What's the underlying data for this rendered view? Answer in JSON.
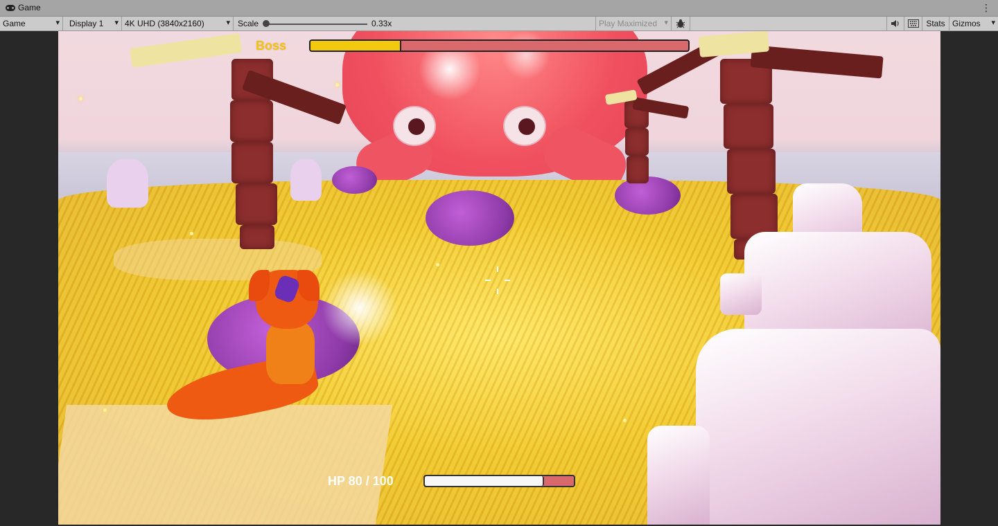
{
  "window": {
    "tab_title": "Game",
    "tab_icon": "gamepad-icon",
    "menu_icon": "kebab-menu-icon"
  },
  "toolbar": {
    "view_select": "Game",
    "display_select": "Display 1",
    "resolution_select": "4K UHD (3840x2160)",
    "scale_label": "Scale",
    "scale_value": "0.33x",
    "scale_fraction": 0.0,
    "play_mode_select": "Play Maximized",
    "debug_icon": "bug-icon",
    "audio_icon": "speaker-icon",
    "grid_icon": "keyboard-grid-icon",
    "stats_button": "Stats",
    "gizmos_button": "Gizmos"
  },
  "hud": {
    "boss_label": "Boss",
    "boss_health_fraction": 0.24,
    "hp_label": "HP 80 / 100",
    "player_health_fraction": 0.8,
    "colors": {
      "boss_fill": "#f3c910",
      "bar_empty": "#d9696d",
      "hp_fill": "#f7f7f7",
      "boss_text": "#f4c20d"
    }
  }
}
